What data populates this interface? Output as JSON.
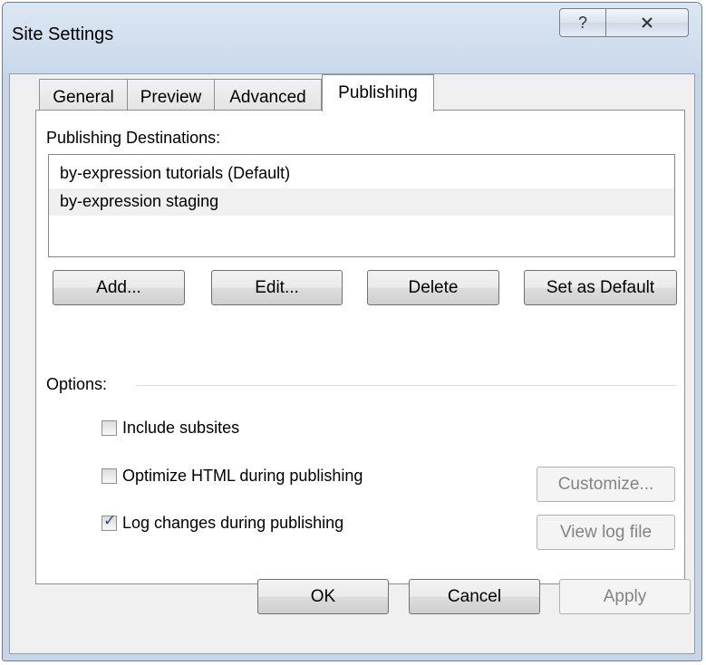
{
  "window": {
    "title": "Site Settings",
    "help_icon": "?",
    "close_icon": "X"
  },
  "tabs": [
    {
      "label": "General"
    },
    {
      "label": "Preview"
    },
    {
      "label": "Advanced"
    },
    {
      "label": "Publishing",
      "active": true
    }
  ],
  "publishing": {
    "destinations_label": "Publishing Destinations:",
    "destinations": [
      {
        "label": "by-expression tutorials (Default)"
      },
      {
        "label": "by-expression staging",
        "selected": true
      }
    ],
    "buttons": {
      "add": "Add...",
      "edit": "Edit...",
      "delete": "Delete",
      "set_default": "Set as Default"
    },
    "options_label": "Options:",
    "options": {
      "include_subsites": {
        "label": "Include subsites",
        "checked": false
      },
      "optimize_html": {
        "label": "Optimize HTML during publishing",
        "checked": false
      },
      "log_changes": {
        "label": "Log changes during publishing",
        "checked": true
      }
    },
    "customize_label": "Customize...",
    "view_log_label": "View log file"
  },
  "footer": {
    "ok": "OK",
    "cancel": "Cancel",
    "apply": "Apply"
  }
}
